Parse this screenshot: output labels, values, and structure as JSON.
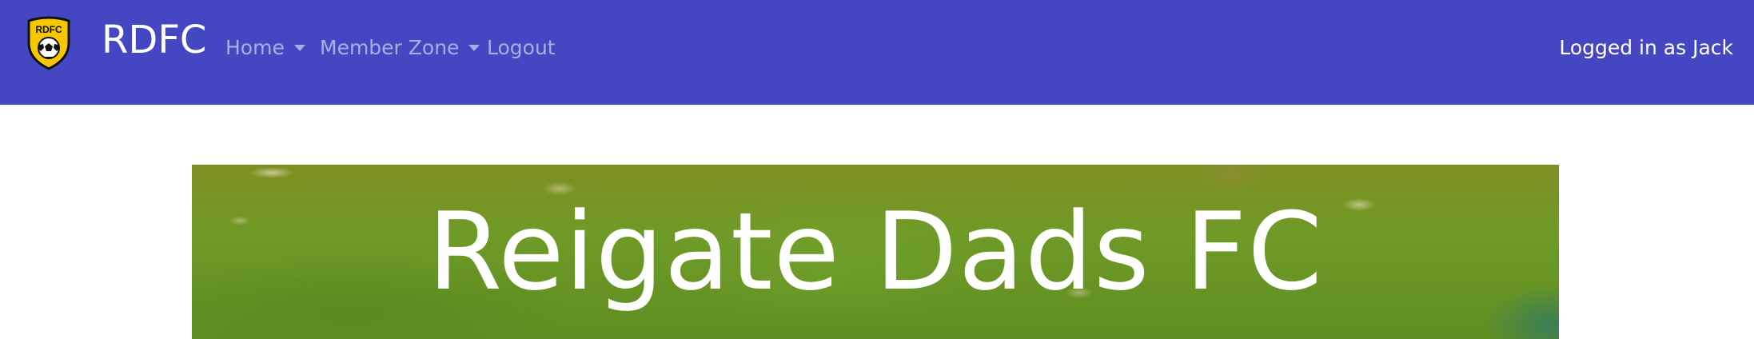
{
  "brand": {
    "name": "RDFC",
    "logo_text": "RDFC",
    "logo_icon": "football-crest-icon",
    "colors": {
      "shield": "#f6c700",
      "outline": "#111111"
    }
  },
  "nav": {
    "items": [
      {
        "label": "Home",
        "dropdown": true
      },
      {
        "label": "Member Zone",
        "dropdown": true
      },
      {
        "label": "Logout",
        "dropdown": false
      }
    ]
  },
  "user": {
    "status": "Logged in as Jack"
  },
  "hero": {
    "title": "Reigate Dads FC"
  },
  "colors": {
    "navbar": "#4547c2",
    "nav_text": "#ffffff"
  }
}
